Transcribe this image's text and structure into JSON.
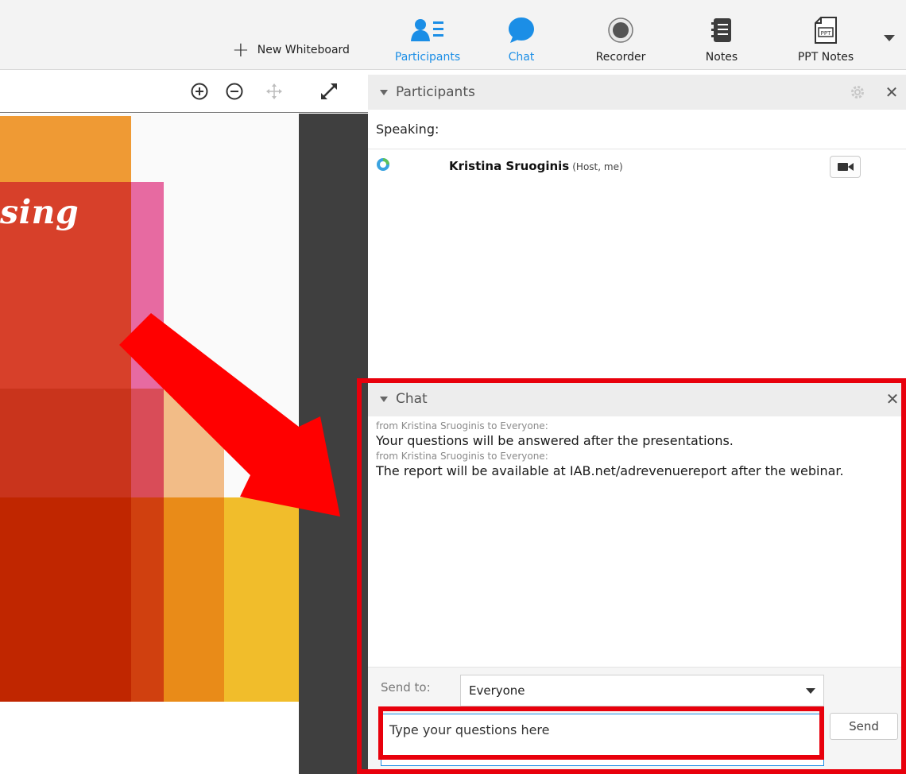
{
  "toolbar": {
    "new_whiteboard_label": "New Whiteboard",
    "tools": [
      {
        "id": "participants",
        "label": "Participants",
        "icon": "participants-icon",
        "active": true
      },
      {
        "id": "chat",
        "label": "Chat",
        "icon": "chat-bubble-icon",
        "active": true
      },
      {
        "id": "recorder",
        "label": "Recorder",
        "icon": "record-icon",
        "active": false
      },
      {
        "id": "notes",
        "label": "Notes",
        "icon": "notes-icon",
        "active": false
      },
      {
        "id": "ppt-notes",
        "label": "PPT Notes",
        "icon": "ppt-file-icon",
        "active": false
      }
    ],
    "accent_color": "#1b8ee6"
  },
  "viewer": {
    "controls": [
      "zoom-in-icon",
      "zoom-out-icon",
      "pan-icon",
      "fullscreen-icon"
    ],
    "slide_title_fragment": "sing",
    "slide_colors": [
      "#ef9a34",
      "#d7402a",
      "#e76aa1",
      "#c9341c",
      "#d94c58",
      "#f2bc87",
      "#c02600",
      "#d0400f",
      "#e98b18",
      "#f1bd2b",
      "#3f3f3f"
    ]
  },
  "participants": {
    "section_title": "Participants",
    "speaking_label": "Speaking:",
    "list": [
      {
        "name": "Kristina Sruoginis",
        "role": "(Host, me)"
      }
    ]
  },
  "chat": {
    "section_title": "Chat",
    "messages": [
      {
        "from": "from Kristina Sruoginis to Everyone:",
        "text": "Your questions will be answered after the presentations."
      },
      {
        "from": "from Kristina Sruoginis to Everyone:",
        "text": "The report will be available at IAB.net/adrevenuereport after the webinar."
      }
    ],
    "send_to_label": "Send to:",
    "send_to_value": "Everyone",
    "input_placeholder": "Type your questions here",
    "send_label": "Send"
  },
  "annotations": {
    "highlight_color": "#e8000c"
  }
}
